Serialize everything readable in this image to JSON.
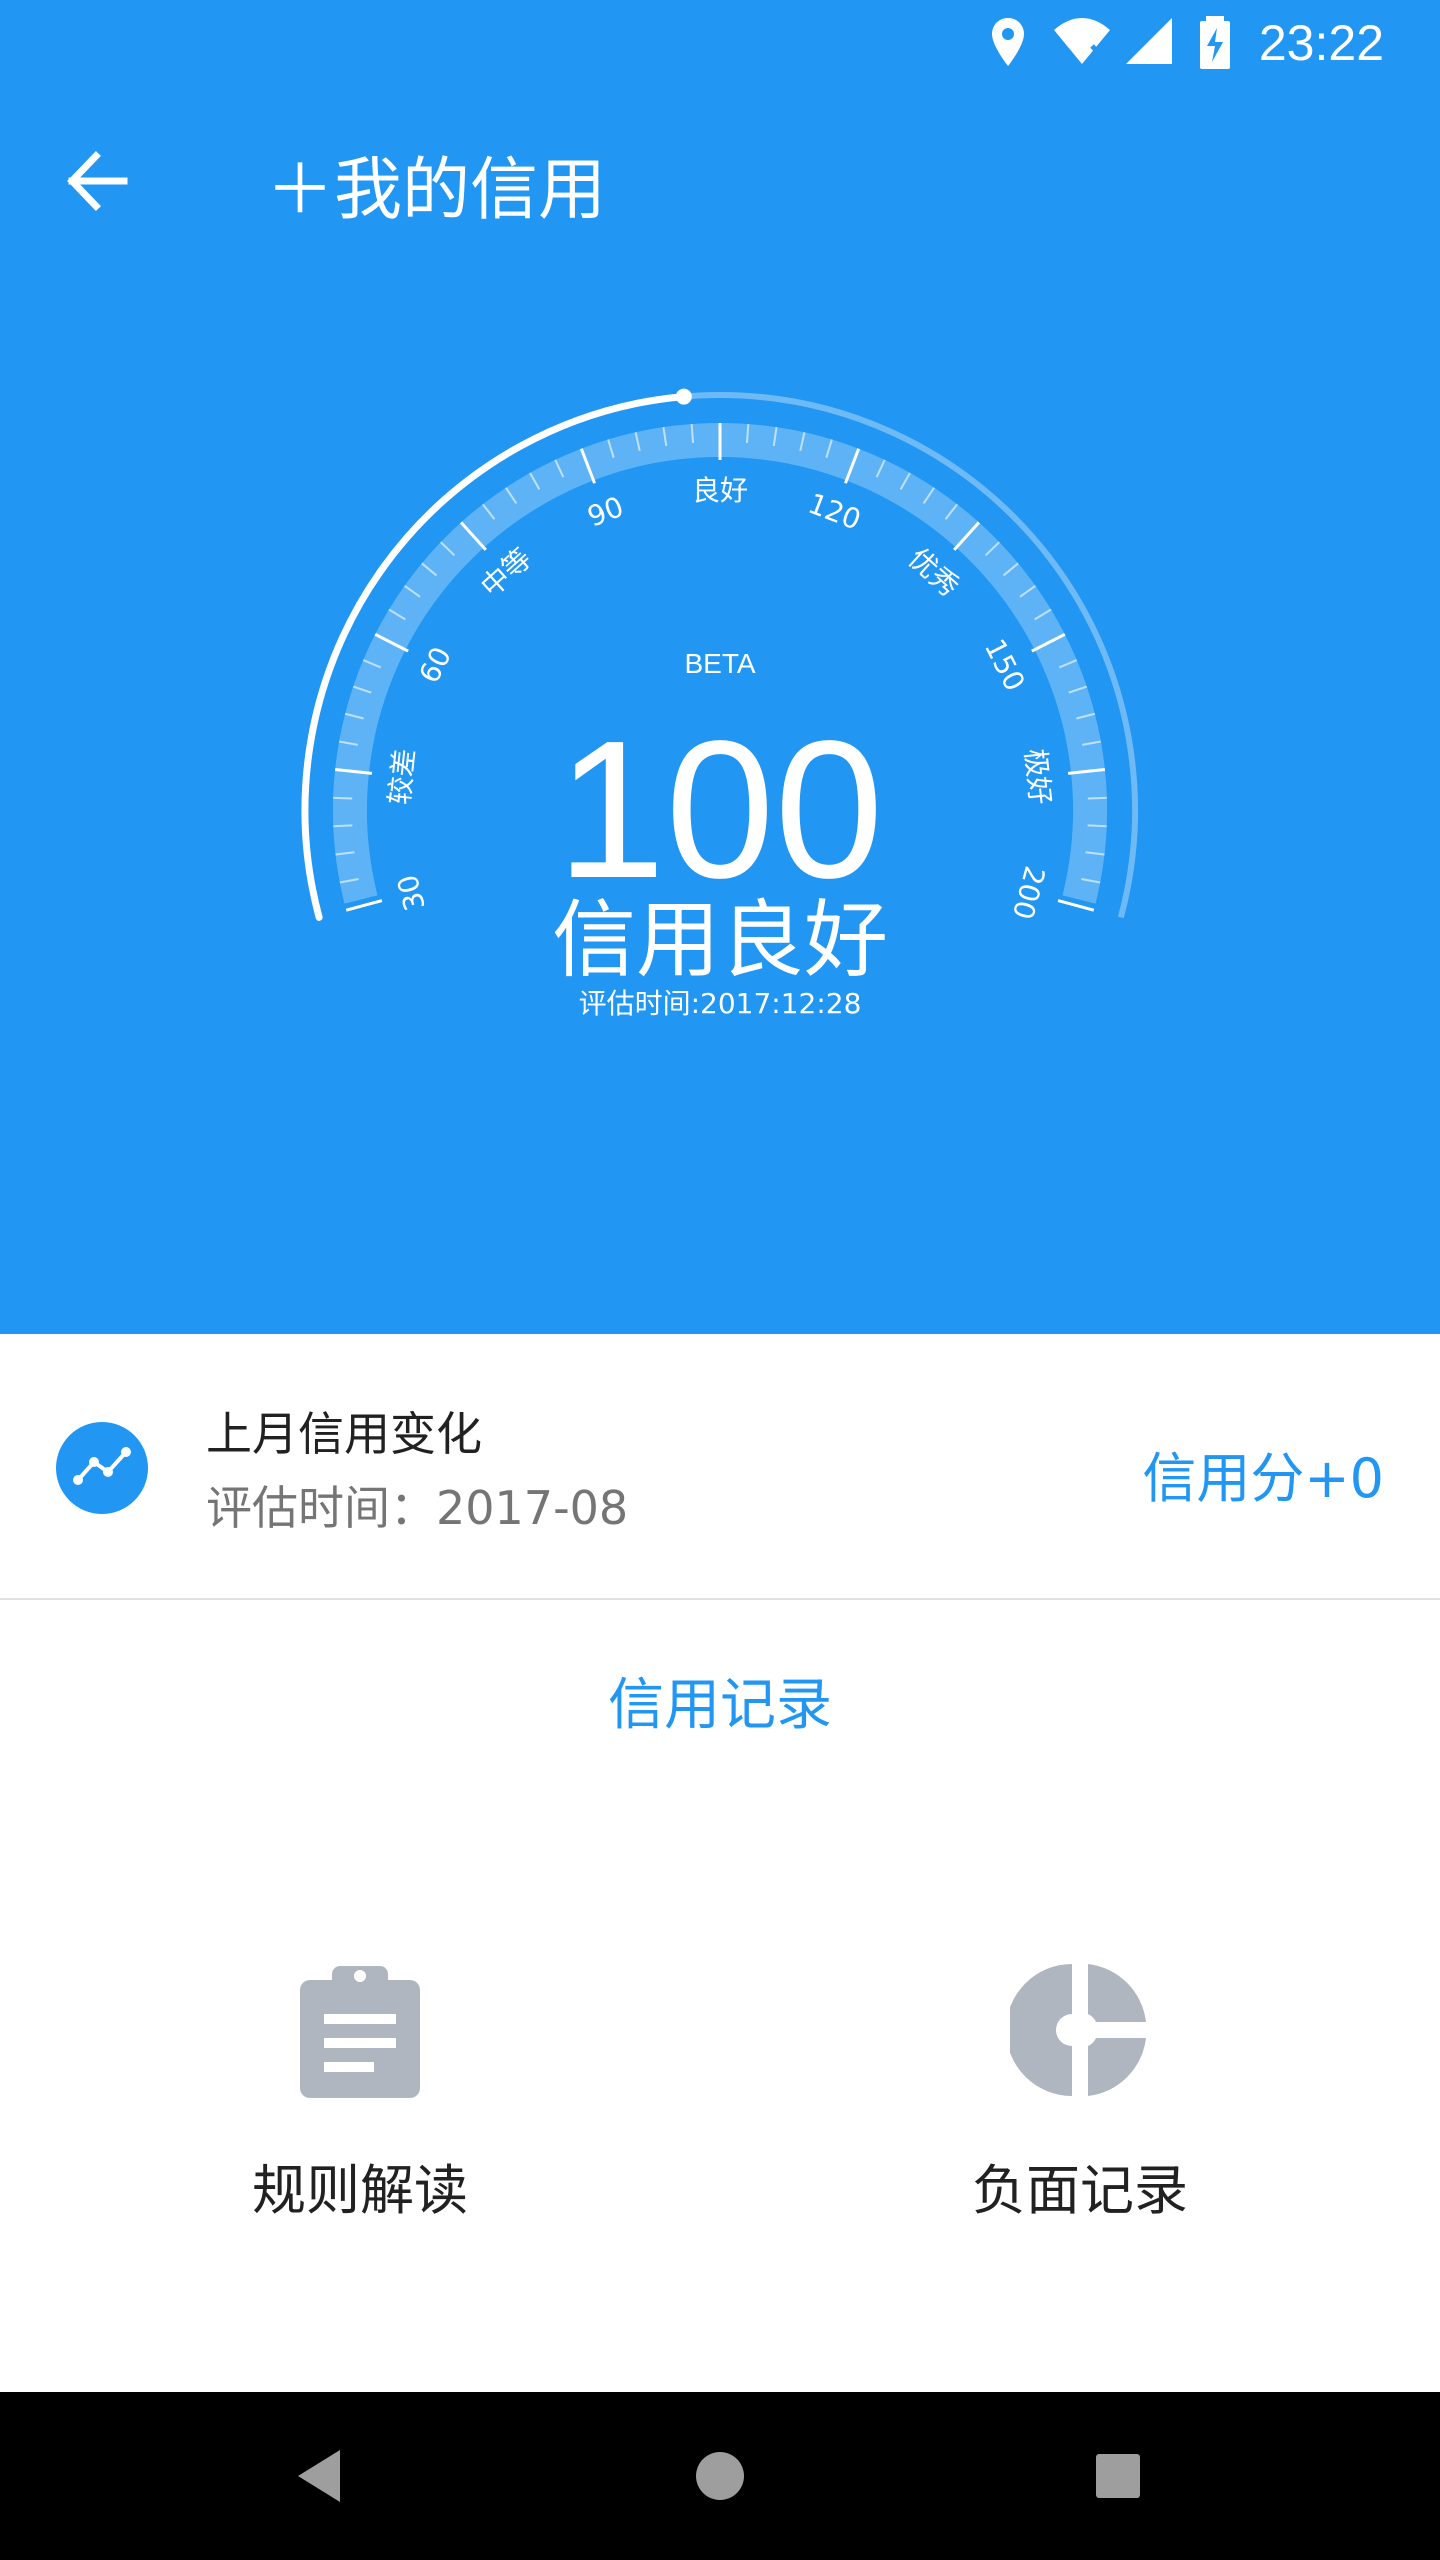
{
  "status_bar": {
    "time": "23:22",
    "icons": [
      "location-icon",
      "wifi-off-icon",
      "signal-icon",
      "battery-charging-icon"
    ]
  },
  "toolbar": {
    "title": "＋我的信用",
    "back_icon": "arrow-back-icon"
  },
  "gauge": {
    "beta_label": "BETA",
    "score": "100",
    "level": "信用良好",
    "eval_time": "评估时间:2017:12:28",
    "scale_labels": [
      "30",
      "较差",
      "60",
      "中等",
      "90",
      "良好",
      "120",
      "优秀",
      "150",
      "极好",
      "200"
    ]
  },
  "credit_change": {
    "icon": "trend-line-icon",
    "title": "上月信用变化",
    "subtitle": "评估时间：2017-08",
    "score_change": "信用分+0"
  },
  "records": {
    "title": "信用记录",
    "items": [
      {
        "label": "规则解读",
        "icon": "clipboard-icon"
      },
      {
        "label": "负面记录",
        "icon": "pie-chart-icon"
      }
    ]
  },
  "colors": {
    "primary": "#2196F3",
    "icon_gray": "#B0B6C0"
  }
}
